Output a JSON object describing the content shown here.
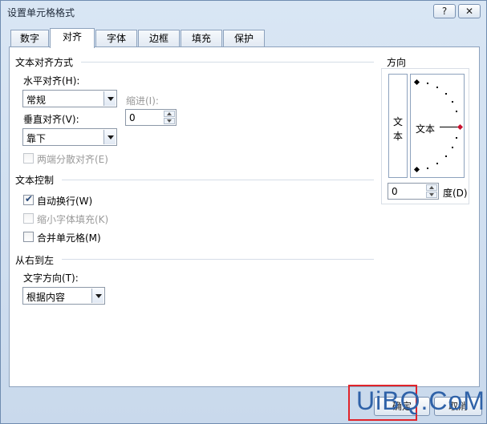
{
  "window": {
    "title": "设置单元格格式",
    "help_label": "?",
    "close_label": "✕"
  },
  "tabs": [
    {
      "label": "数字"
    },
    {
      "label": "对齐",
      "active": true
    },
    {
      "label": "字体"
    },
    {
      "label": "边框"
    },
    {
      "label": "填充"
    },
    {
      "label": "保护"
    }
  ],
  "text_alignment": {
    "title": "文本对齐方式",
    "horizontal_label": "水平对齐(H):",
    "horizontal_value": "常规",
    "indent_label": "缩进(I):",
    "indent_value": "0",
    "vertical_label": "垂直对齐(V):",
    "vertical_value": "靠下",
    "justify_distributed_label": "两端分散对齐(E)"
  },
  "text_control": {
    "title": "文本控制",
    "wrap_text_label": "自动换行(W)",
    "wrap_text_checked": true,
    "shrink_to_fit_label": "缩小字体填充(K)",
    "merge_cells_label": "合并单元格(M)"
  },
  "rtl": {
    "title": "从右到左",
    "text_direction_label": "文字方向(T):",
    "text_direction_value": "根据内容"
  },
  "orientation": {
    "title": "方向",
    "vertical_text": "文本",
    "dial_text": "文本",
    "degrees_value": "0",
    "degrees_label": "度(D)"
  },
  "footer": {
    "ok_label": "确定",
    "cancel_label": "取消",
    "watermark": "UiBQ.CoM"
  },
  "colors": {
    "highlight_frame": "#e0242b",
    "watermark": "#2f62a8",
    "dial_marker": "#c8102e"
  }
}
